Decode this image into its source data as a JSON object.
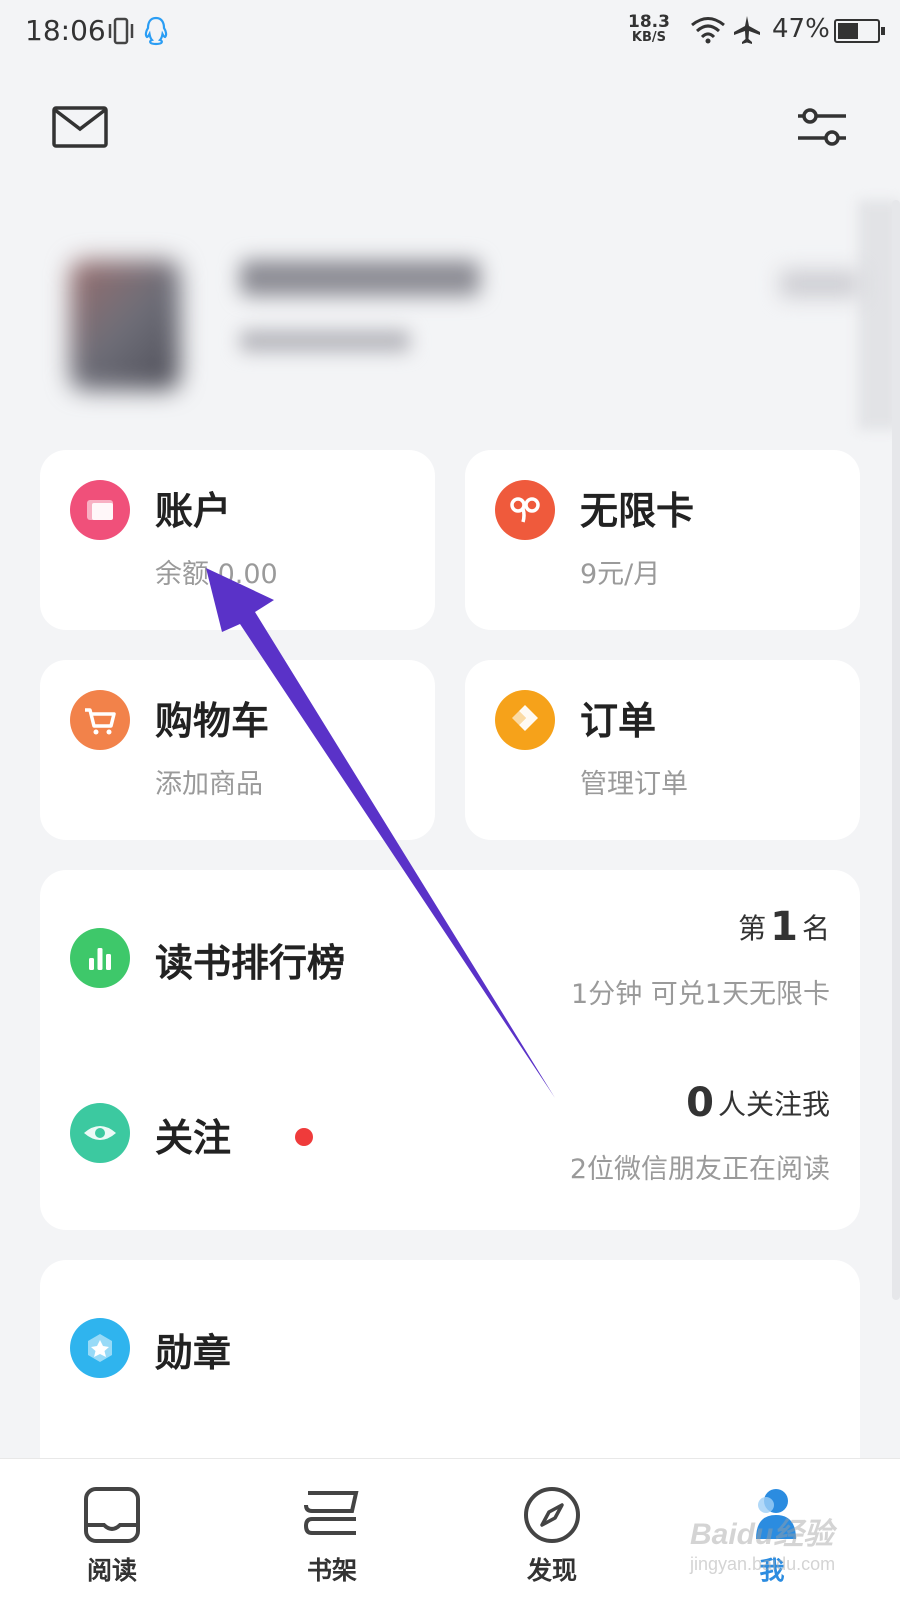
{
  "status_bar": {
    "time": "18:06",
    "net_speed_value": "18.3",
    "net_speed_unit": "KB/S",
    "battery": "47%"
  },
  "header": {
    "mail_icon": "mail-icon",
    "settings_icon": "sliders-icon"
  },
  "cards": {
    "account": {
      "title": "账户",
      "sub": "余额 0.00",
      "icon": "wallet-icon",
      "color": "#f0507a"
    },
    "unlimited": {
      "title": "无限卡",
      "sub": "9元/月",
      "icon": "infinity-card-icon",
      "color": "#ef5a3c"
    },
    "cart": {
      "title": "购物车",
      "sub": "添加商品",
      "icon": "cart-icon",
      "color": "#f2824a"
    },
    "orders": {
      "title": "订单",
      "sub": "管理订单",
      "icon": "order-icon",
      "color": "#f6a21a"
    }
  },
  "ranking": {
    "title": "读书排行榜",
    "rank_prefix": "第",
    "rank_value": "1",
    "rank_suffix": "名",
    "sub": "1分钟 可兑1天无限卡",
    "icon": "bar-chart-icon",
    "color": "#3ec86a"
  },
  "follow": {
    "title": "关注",
    "count": "0",
    "count_suffix": "人关注我",
    "sub": "2位微信朋友正在阅读",
    "icon": "eye-icon",
    "color": "#3cc9a0",
    "dot_color": "#ef3b3b"
  },
  "medal": {
    "title": "勋章",
    "icon": "medal-icon",
    "color": "#2fb4ee"
  },
  "bottom_nav": {
    "items": [
      {
        "label": "阅读",
        "icon": "book-icon"
      },
      {
        "label": "书架",
        "icon": "shelf-icon"
      },
      {
        "label": "发现",
        "icon": "compass-icon"
      },
      {
        "label": "我",
        "icon": "person-icon"
      }
    ],
    "active_index": 3,
    "active_color": "#2b8ce0"
  },
  "watermark": {
    "text": "Baidu经验",
    "sub": "jingyan.baidu.com"
  },
  "annotation_color": "#5a32c8"
}
